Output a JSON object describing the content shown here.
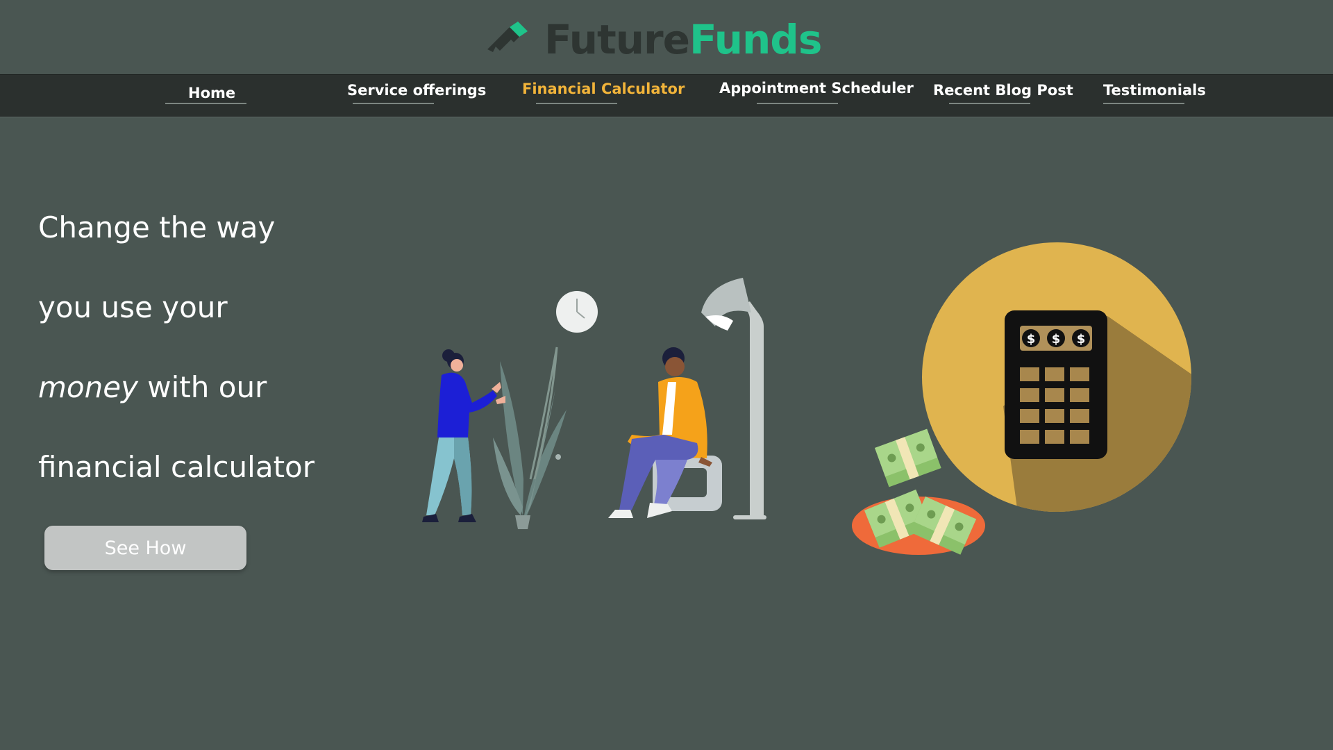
{
  "brand": {
    "name_part1": "Future",
    "name_part2": "Funds",
    "accent_color": "#1fc38a",
    "dark_color": "#2e3532"
  },
  "nav": {
    "active_color": "#f2b43a",
    "items": [
      {
        "label": "Home"
      },
      {
        "label": "Service offerings"
      },
      {
        "label": "Financial Calculator",
        "active": true
      },
      {
        "label": "Appointment Scheduler"
      },
      {
        "label": "Recent Blog Post"
      },
      {
        "label": "Testimonials"
      }
    ]
  },
  "hero": {
    "line1": "Change the way",
    "line2": "you use your",
    "line3_em": "money",
    "line3_rest": " with our",
    "line4": "financial calculator",
    "cta_label": "See How"
  },
  "illustrations": {
    "left_scene_icon": "two-people-meeting-illustration",
    "right_scene_icon": "calculator-with-money-illustration",
    "calculator_symbol": "$"
  }
}
